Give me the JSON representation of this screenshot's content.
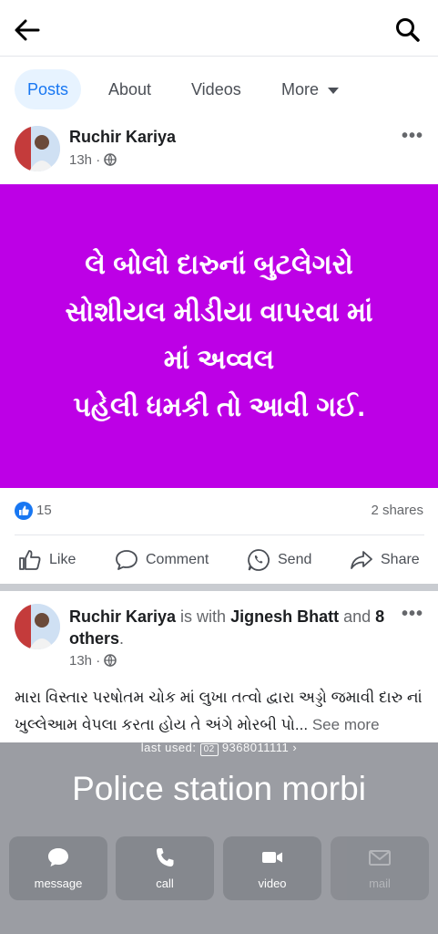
{
  "header": {
    "back_icon": "arrow-left-icon",
    "search_icon": "search-icon"
  },
  "tabs": [
    {
      "label": "Posts",
      "active": true
    },
    {
      "label": "About"
    },
    {
      "label": "Videos"
    },
    {
      "label": "More"
    }
  ],
  "post1": {
    "author": "Ruchir Kariya",
    "time": "13h",
    "privacy_icon": "globe-icon",
    "banner_lines": [
      "લે બોલો દારુનાં બુટલેગરો",
      "સોશીયલ મીડીયા વાપરવા માં",
      "માં અવ્વલ",
      "પહેલી ધમકી તો આવી ગઈ."
    ],
    "banner_color": "#bd00e6",
    "reactions_count": "15",
    "shares": "2 shares",
    "actions": {
      "like": "Like",
      "comment": "Comment",
      "send": "Send",
      "share": "Share"
    }
  },
  "post2": {
    "author": "Ruchir Kariya",
    "with_text": " is with ",
    "tagged": "Jignesh Bhatt",
    "and_text": " and ",
    "others": "8 others",
    "time": "13h",
    "body": "મારા વિસ્તાર પરષોતમ ચોક માં લુખા તત્વો દ્વારા અડ્ડો જમાવી દારુ નાં ખુલ્લેઆમ વેપલા કરતા હોય તે અંગે મોરબી પો...",
    "see_more": "See more"
  },
  "contact_sheet": {
    "last_used_label": "last used:",
    "sim_badge": "SIM 2",
    "last_used_number": "9368011111",
    "title": "Police station morbi",
    "buttons": [
      {
        "label": "message",
        "icon": "chat-bubble-icon"
      },
      {
        "label": "call",
        "icon": "phone-icon"
      },
      {
        "label": "video",
        "icon": "video-camera-icon"
      },
      {
        "label": "mail",
        "icon": "mail-icon",
        "disabled": true
      }
    ]
  }
}
